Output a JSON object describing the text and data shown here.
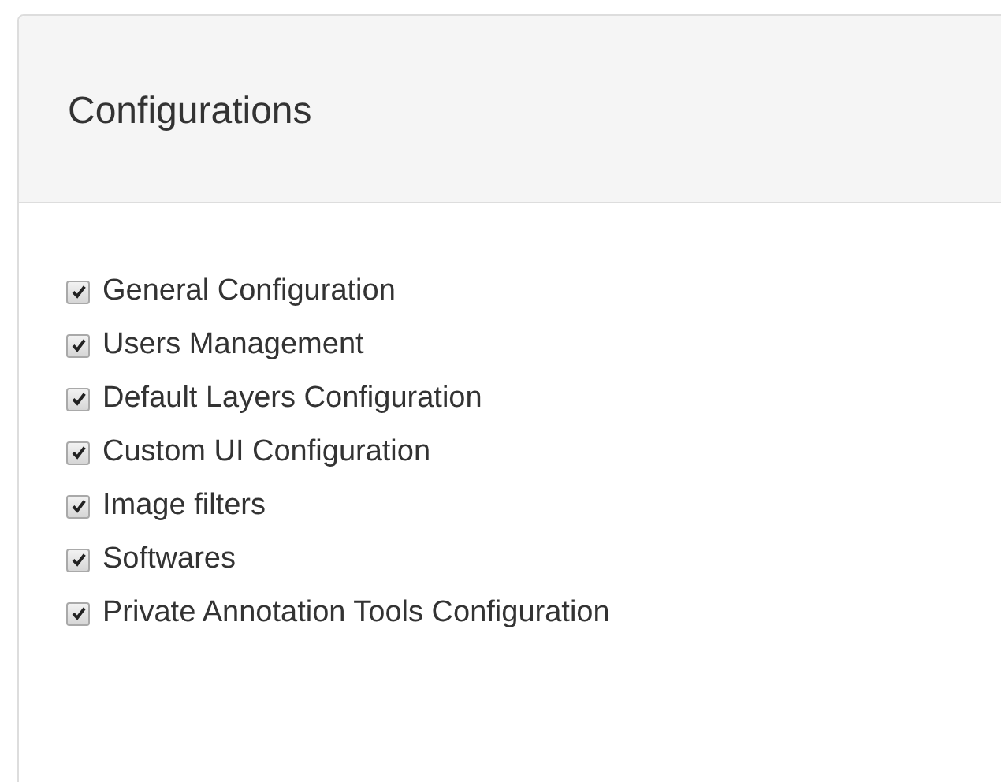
{
  "panel": {
    "title": "Configurations"
  },
  "options": [
    {
      "label": "General Configuration",
      "checked": true
    },
    {
      "label": "Users Management",
      "checked": true
    },
    {
      "label": "Default Layers Configuration",
      "checked": true
    },
    {
      "label": "Custom UI Configuration",
      "checked": true
    },
    {
      "label": "Image filters",
      "checked": true
    },
    {
      "label": "Softwares",
      "checked": true
    },
    {
      "label": "Private Annotation Tools Configuration",
      "checked": true
    }
  ]
}
